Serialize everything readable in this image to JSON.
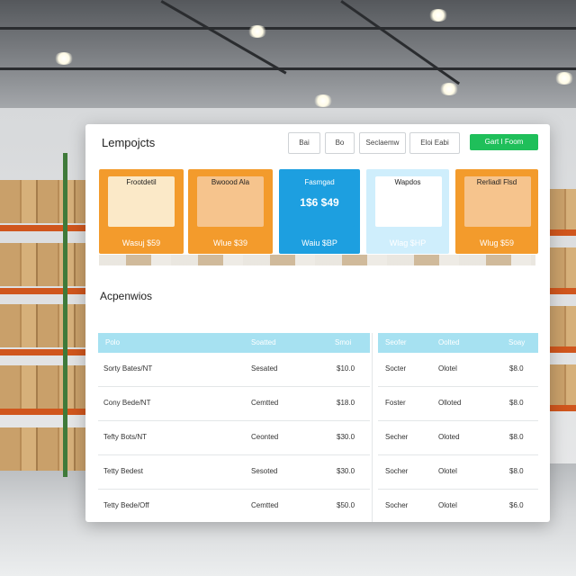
{
  "app": {
    "title": "Lempojcts",
    "toolbar": [
      {
        "label": "Bai"
      },
      {
        "label": "Bo"
      },
      {
        "label": "Seclaemw"
      },
      {
        "label": "Eloi Eabi"
      }
    ],
    "cta_label": "Gart I Foom",
    "accent": "#1fbf5a"
  },
  "product_cards": [
    {
      "headline": "Frootdetil",
      "big": "",
      "price": "Wasuj $59",
      "bg": "#f39b2c",
      "img": "#fbe9c8",
      "label_color": "#1f1f1f"
    },
    {
      "headline": "Bwoood Ala",
      "big": "",
      "price": "Wlue $39",
      "bg": "#f39b2c",
      "img": "#f6c48d",
      "label_color": "#1f1f1f"
    },
    {
      "headline": "Fasmgad",
      "big": "1$6 $49",
      "price": "Waiu $BP",
      "bg": "#1d9fe0",
      "img": "#1d9fe0",
      "label_color": "#ffffff"
    },
    {
      "headline": "Wapdos",
      "big": "",
      "price": "Wlag $HP",
      "bg": "#cfeefc",
      "img": "#ffffff",
      "label_color": "#1f1f1f"
    },
    {
      "headline": "Rerliadl Flsd",
      "big": "",
      "price": "Wlug $59",
      "bg": "#f39b2c",
      "img": "#f6c48d",
      "label_color": "#1f1f1f"
    }
  ],
  "section": {
    "title": "Acpenwios"
  },
  "left_table": {
    "headers": [
      "Polo",
      "Soatted",
      "Smoi"
    ],
    "rows": [
      [
        "Sorty Bates/NT",
        "Sesated",
        "$10.0"
      ],
      [
        "Cony Bede/NT",
        "Cemtted",
        "$18.0"
      ],
      [
        "Tefty Bots/NT",
        "Ceonted",
        "$30.0"
      ],
      [
        "Tetty Bedest",
        "Sesoted",
        "$30.0"
      ],
      [
        "Tetty Bede/Off",
        "Cemtted",
        "$50.0"
      ]
    ],
    "header_color": "#a6e1f1"
  },
  "right_table": {
    "headers": [
      "Seofer",
      "Oolted",
      "Soay"
    ],
    "rows": [
      [
        "Socter",
        "Olotel",
        "$8.0"
      ],
      [
        "Foster",
        "Olloted",
        "$8.0"
      ],
      [
        "Secher",
        "Oloted",
        "$8.0"
      ],
      [
        "Socher",
        "Olotel",
        "$8.0"
      ],
      [
        "Socher",
        "Olotel",
        "$6.0"
      ]
    ]
  }
}
